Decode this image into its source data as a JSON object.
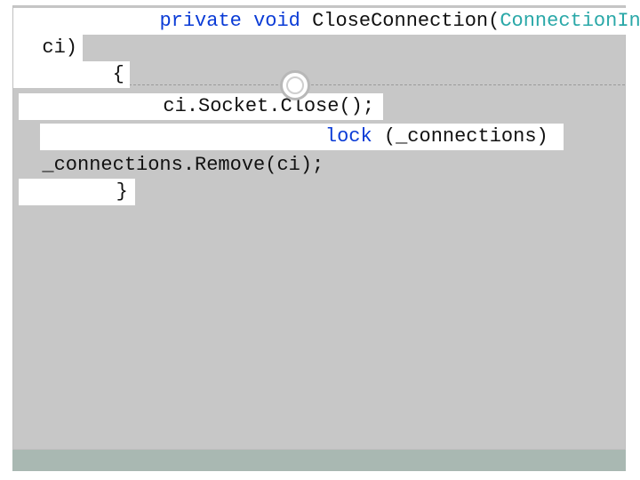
{
  "code": {
    "line1": {
      "kw_private": "private",
      "kw_void": "void",
      "method": " CloseConnection(",
      "type": "ConnectionInfo",
      "param_line1_end": "",
      "param_line2": "  ci)"
    },
    "line_brace_open": "        {",
    "line_close_call": "            ci.Socket.Close();",
    "line_lock": {
      "indent": "            ",
      "kw_lock": "lock",
      "rest": " (_connections) "
    },
    "line_remove": "  _connections.Remove(ci);",
    "line_brace_close": "        }"
  }
}
